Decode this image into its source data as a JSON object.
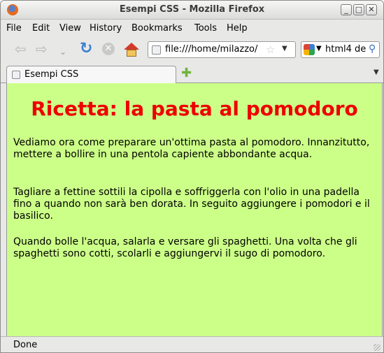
{
  "window": {
    "title": "Esempi CSS - Mozilla Firefox"
  },
  "menubar": {
    "file": "File",
    "edit": "Edit",
    "view": "View",
    "history": "History",
    "bookmarks": "Bookmarks",
    "tools": "Tools",
    "help": "Help"
  },
  "navbar": {
    "url": "file:///home/milazzo/",
    "search_text": "html4 de"
  },
  "tabs": {
    "active_label": "Esempi CSS"
  },
  "page": {
    "heading": "Ricetta: la pasta al pomodoro",
    "paragraphs": [
      "Vediamo ora come preparare un'ottima pasta al pomodoro. Innanzitutto, mettere a bollire in una pentola capiente abbondante acqua.",
      "Tagliare a fettine sottili la cipolla e soffriggerla con l'olio in una padella fino a quando non sarà ben dorata. In seguito aggiungere i pomodori e il basilico.",
      "Quando bolle l'acqua, salarla e versare gli spaghetti. Una volta che gli spaghetti sono cotti, scolarli e aggiungervi il sugo di pomodoro."
    ],
    "background_color": "#ccff88",
    "heading_color": "#ee0000"
  },
  "statusbar": {
    "text": "Done"
  }
}
